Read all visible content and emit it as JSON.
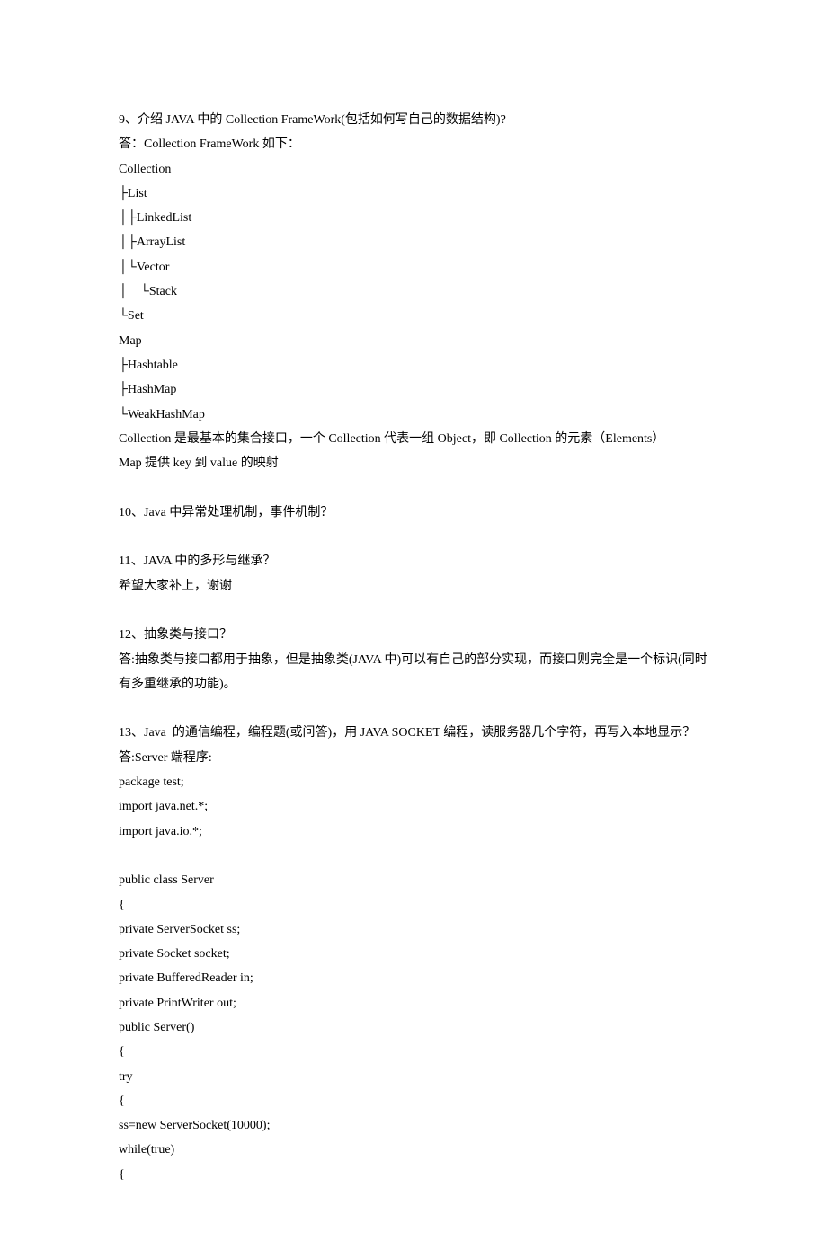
{
  "lines": [
    "9、介绍 JAVA 中的 Collection FrameWork(包括如何写自己的数据结构)?",
    "答：Collection FrameWork 如下：",
    "Collection",
    "├List",
    "│├LinkedList",
    "│├ArrayList",
    "│└Vector",
    "│　└Stack",
    "└Set",
    "Map",
    "├Hashtable",
    "├HashMap",
    "└WeakHashMap",
    "Collection 是最基本的集合接口，一个 Collection 代表一组 Object，即 Collection 的元素（Elements）",
    "Map 提供 key 到 value 的映射",
    "",
    "10、Java 中异常处理机制，事件机制？",
    "",
    "11、JAVA 中的多形与继承？",
    "希望大家补上，谢谢",
    "",
    "12、抽象类与接口？",
    "答:抽象类与接口都用于抽象，但是抽象类(JAVA 中)可以有自己的部分实现，而接口则完全是一个标识(同时有多重继承的功能)。",
    "",
    "13、Java  的通信编程，编程题(或问答)，用 JAVA SOCKET 编程，读服务器几个字符，再写入本地显示？",
    "答:Server 端程序:",
    "package test;",
    "import java.net.*;",
    "import java.io.*;",
    "",
    "public class Server",
    "{",
    "private ServerSocket ss;",
    "private Socket socket;",
    "private BufferedReader in;",
    "private PrintWriter out;",
    "public Server()",
    "{",
    "try",
    "{",
    "ss=new ServerSocket(10000);",
    "while(true)",
    "{"
  ]
}
